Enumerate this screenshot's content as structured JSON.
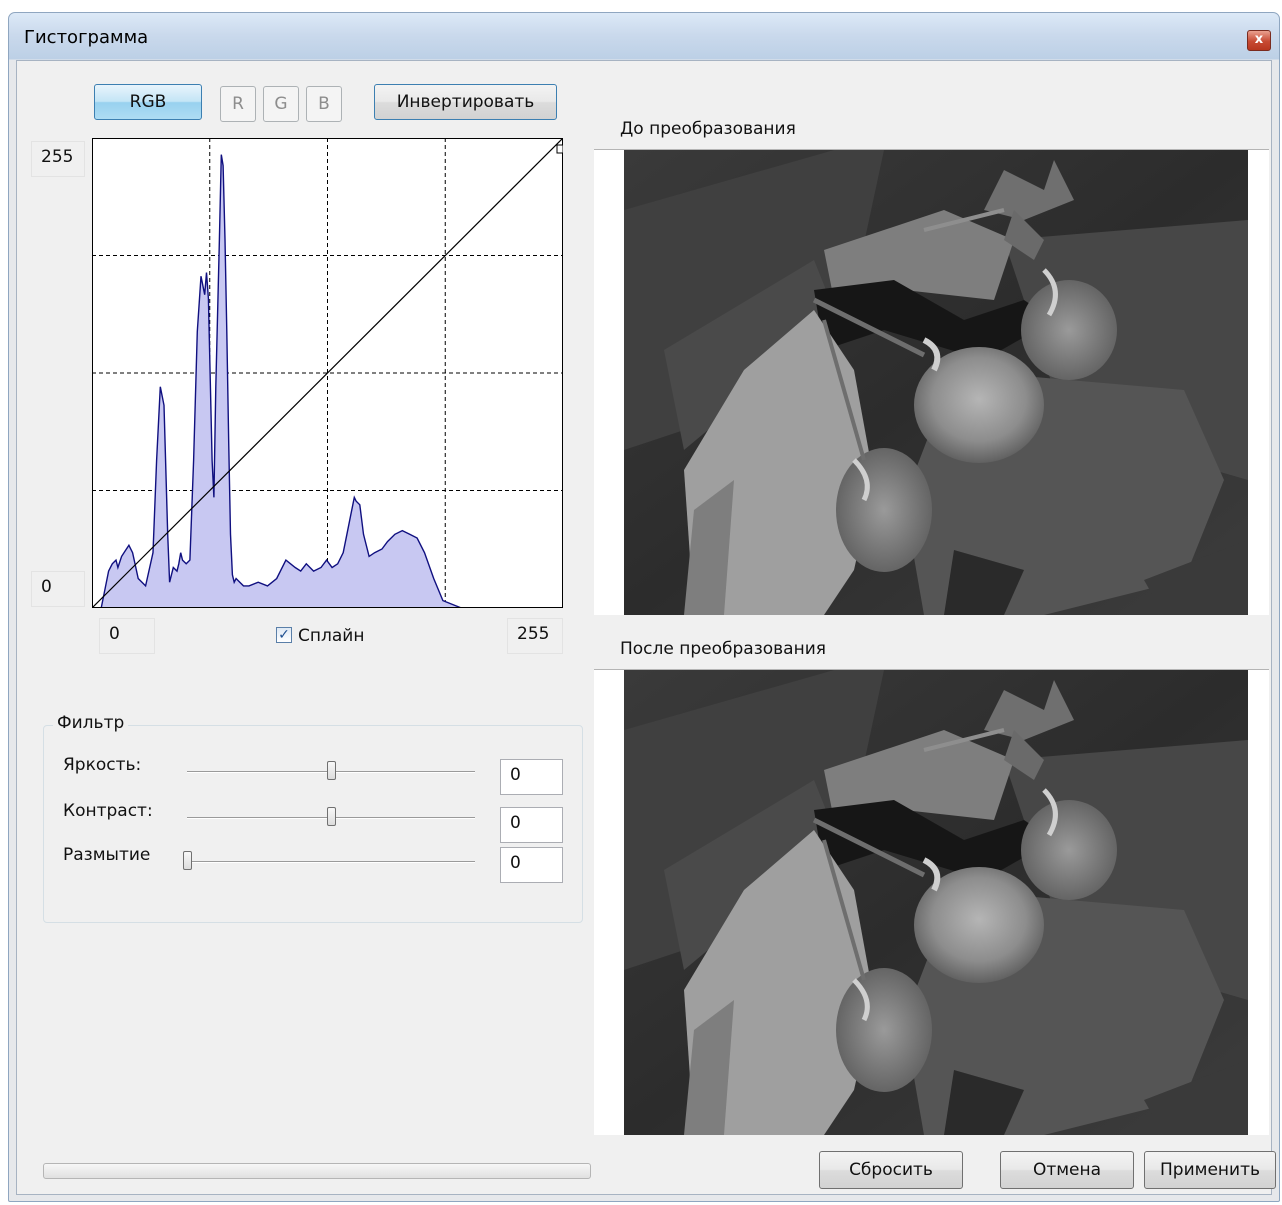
{
  "window": {
    "title": "Гистограмма",
    "close_glyph": "x",
    "close_icon": "close-icon"
  },
  "channels": {
    "rgb": "RGB",
    "r": "R",
    "g": "G",
    "b": "B",
    "invert": "Инвертировать"
  },
  "curve": {
    "y_max": "255",
    "y_min": "0",
    "x_min": "0",
    "x_max": "255",
    "spline_label": "Сплайн",
    "spline_checked": true,
    "spline_check_glyph": "✓",
    "check_icon": "checkmark-icon"
  },
  "chart_data": {
    "type": "area",
    "x_range": [
      0,
      255
    ],
    "y_range": [
      0,
      255
    ],
    "grid": true,
    "grid_divisions": 4,
    "histogram_fill": "#c8c8f2",
    "histogram_stroke": "#101080",
    "histogram": {
      "x": [
        0,
        5,
        7,
        9,
        11,
        13,
        14,
        16,
        18,
        20,
        22,
        25,
        29,
        33,
        35,
        37,
        39,
        41,
        42,
        44,
        46,
        47,
        48,
        49,
        51,
        53,
        55,
        57,
        59,
        61,
        62,
        63,
        65,
        66,
        67,
        69,
        70,
        71,
        72,
        73,
        74,
        75,
        76,
        77,
        78,
        80,
        82,
        85,
        90,
        95,
        100,
        105,
        110,
        113,
        116,
        120,
        124,
        127,
        130,
        133,
        136,
        138,
        140,
        142,
        143,
        145,
        147,
        150,
        153,
        157,
        160,
        164,
        168,
        172,
        176,
        180,
        185,
        190,
        200,
        210,
        255
      ],
      "y": [
        0,
        0,
        10,
        20,
        24,
        26,
        22,
        28,
        31,
        34,
        30,
        16,
        12,
        30,
        80,
        120,
        110,
        40,
        14,
        22,
        20,
        24,
        30,
        26,
        24,
        26,
        80,
        150,
        180,
        170,
        182,
        168,
        80,
        60,
        120,
        200,
        246,
        240,
        200,
        150,
        90,
        40,
        18,
        14,
        16,
        14,
        12,
        12,
        14,
        12,
        16,
        26,
        22,
        20,
        24,
        20,
        22,
        26,
        22,
        24,
        30,
        40,
        50,
        60,
        58,
        56,
        40,
        28,
        30,
        32,
        36,
        40,
        42,
        40,
        38,
        30,
        16,
        4,
        0,
        0,
        0
      ]
    },
    "curve_line": {
      "x": [
        0,
        255
      ],
      "y": [
        0,
        255
      ]
    }
  },
  "filter": {
    "title": "Фильтр",
    "brightness_label": "Яркость:",
    "brightness_value": "0",
    "brightness_level": 0.5,
    "contrast_label": "Контраст:",
    "contrast_value": "0",
    "contrast_level": 0.5,
    "blur_label": "Размытие",
    "blur_value": "0",
    "blur_level": 0
  },
  "preview": {
    "before_label": "До преобразования",
    "after_label": "После преобразования"
  },
  "progress": {
    "value": 0
  },
  "actions": {
    "reset": "Сбросить",
    "cancel": "Отмена",
    "apply": "Применить"
  }
}
